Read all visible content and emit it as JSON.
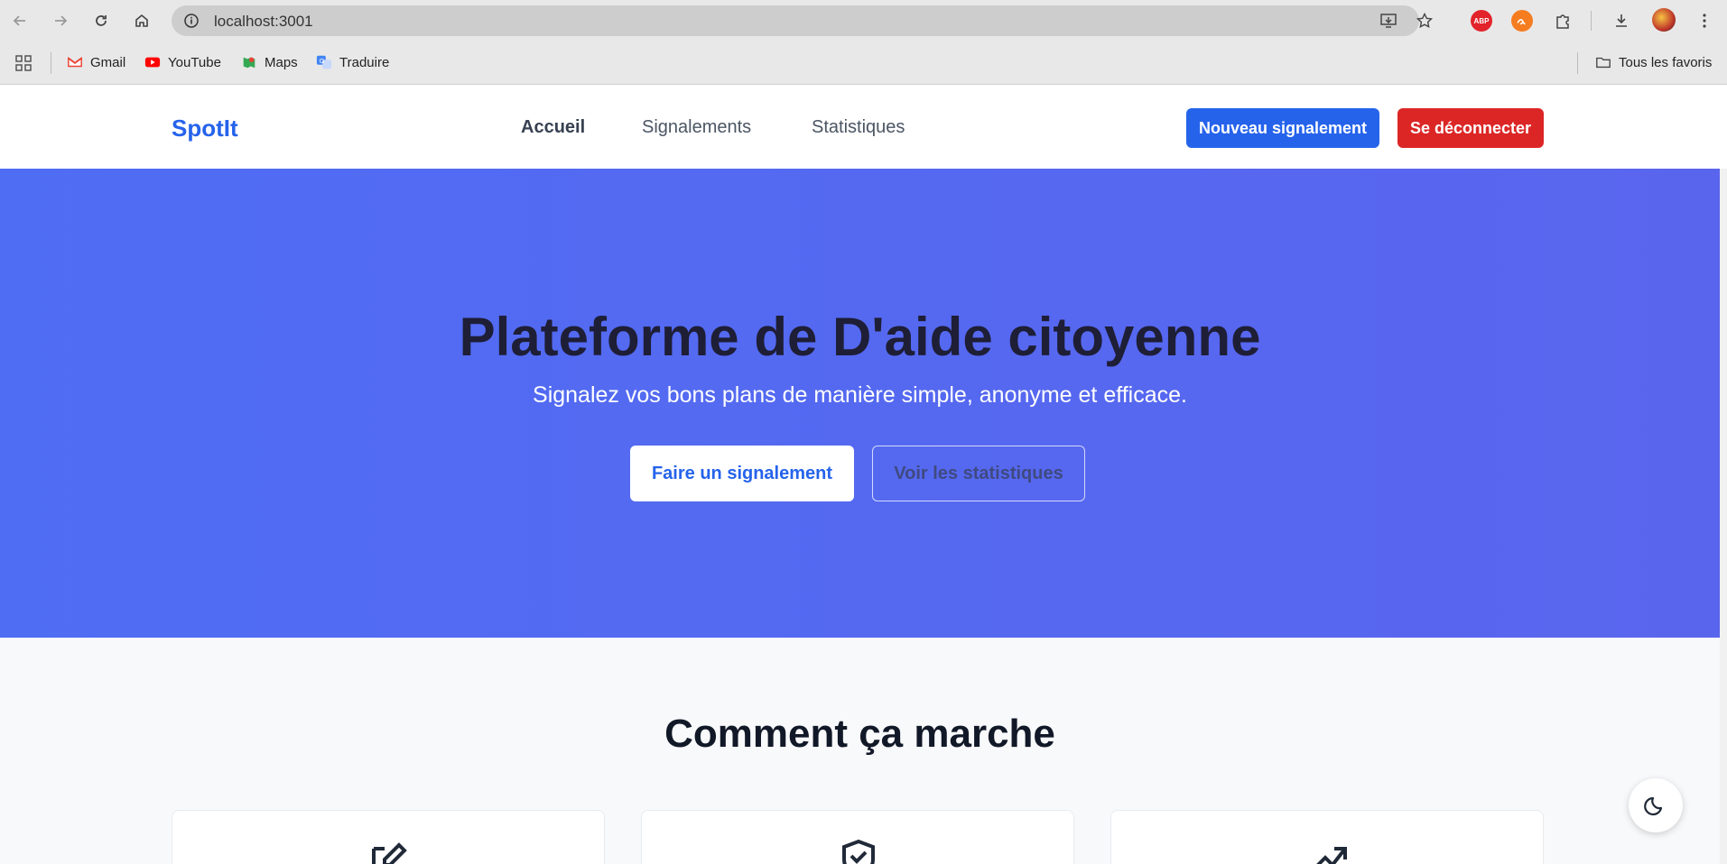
{
  "browser": {
    "url": "localhost:3001",
    "bookmarks": [
      {
        "label": "Gmail",
        "icon": "gmail-icon"
      },
      {
        "label": "YouTube",
        "icon": "youtube-icon"
      },
      {
        "label": "Maps",
        "icon": "maps-icon"
      },
      {
        "label": "Traduire",
        "icon": "translate-icon"
      }
    ],
    "all_bookmarks_label": "Tous les favoris",
    "extensions": {
      "abp": "ABP"
    }
  },
  "header": {
    "brand": "SpotIt",
    "nav": [
      "Accueil",
      "Signalements",
      "Statistiques"
    ],
    "new_report_label": "Nouveau signalement",
    "logout_label": "Se déconnecter"
  },
  "hero": {
    "title": "Plateforme de D'aide citoyenne",
    "subtitle": "Signalez vos bons plans de manière simple, anonyme et efficace.",
    "primary_cta": "Faire un signalement",
    "secondary_cta": "Voir les statistiques"
  },
  "how": {
    "title": "Comment ça marche"
  },
  "colors": {
    "accent": "#2563eb",
    "danger": "#dc2626",
    "hero_start": "#4f6df3",
    "hero_end": "#5a65ee"
  }
}
